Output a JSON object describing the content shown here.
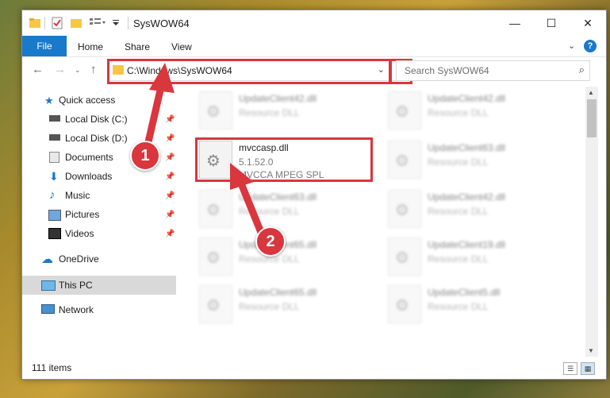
{
  "window": {
    "title": "SysWOW64",
    "controls": {
      "minimize": "—",
      "maximize": "☐",
      "close": "✕"
    }
  },
  "ribbon": {
    "tabs": [
      "File",
      "Home",
      "Share",
      "View"
    ],
    "help": "?"
  },
  "nav": {
    "address": "C:\\Windows\\SysWOW64",
    "search_placeholder": "Search SysWOW64"
  },
  "sidebar": {
    "items": [
      {
        "label": "Quick access",
        "icon": "star-icon"
      },
      {
        "label": "Local Disk (C:)",
        "icon": "drive-icon"
      },
      {
        "label": "Local Disk (D:)",
        "icon": "drive-icon"
      },
      {
        "label": "Documents",
        "icon": "documents-icon"
      },
      {
        "label": "Downloads",
        "icon": "download-icon"
      },
      {
        "label": "Music",
        "icon": "music-icon"
      },
      {
        "label": "Pictures",
        "icon": "pictures-icon"
      },
      {
        "label": "Videos",
        "icon": "videos-icon"
      },
      {
        "label": "OneDrive",
        "icon": "cloud-icon"
      },
      {
        "label": "This PC",
        "icon": "computer-icon"
      },
      {
        "label": "Network",
        "icon": "network-icon"
      }
    ]
  },
  "files": {
    "left": [
      {
        "name": "UpdateClient42.dll",
        "type": "Resource DLL"
      },
      {
        "name": "mvccasp.dll",
        "version": "5.1.52.0",
        "description": "MVCCA MPEG SPL"
      },
      {
        "name": "UpdateClient63.dll",
        "type": "Resource DLL"
      },
      {
        "name": "UpdateClient65.dll",
        "type": "Resource DLL"
      },
      {
        "name": "UpdateClient65.dll",
        "type": "Resource DLL"
      }
    ],
    "right": [
      {
        "name": "UpdateClient42.dll",
        "type": "Resource DLL"
      },
      {
        "name": "UpdateClient63.dll",
        "type": "Resource DLL"
      },
      {
        "name": "UpdateClient42.dll",
        "type": "Resource DLL"
      },
      {
        "name": "UpdateClient19.dll",
        "type": "Resource DLL"
      },
      {
        "name": "UpdateClient5.dll",
        "type": "Resource DLL"
      }
    ]
  },
  "status": {
    "item_count": "111 items"
  },
  "annotations": {
    "step1": "1",
    "step2": "2",
    "color": "#d9363e"
  },
  "colors": {
    "accent": "#1979ca",
    "highlight": "#d9363e",
    "folder": "#f6c746"
  }
}
